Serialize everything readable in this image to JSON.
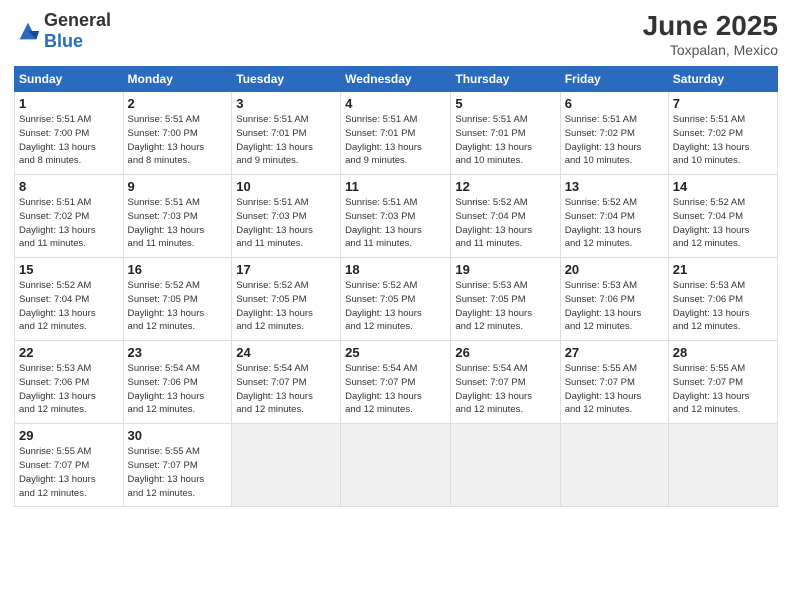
{
  "header": {
    "logo_general": "General",
    "logo_blue": "Blue",
    "month_year": "June 2025",
    "location": "Toxpalan, Mexico"
  },
  "calendar": {
    "days_of_week": [
      "Sunday",
      "Monday",
      "Tuesday",
      "Wednesday",
      "Thursday",
      "Friday",
      "Saturday"
    ],
    "weeks": [
      [
        {
          "day": "1",
          "info": "Sunrise: 5:51 AM\nSunset: 7:00 PM\nDaylight: 13 hours\nand 8 minutes."
        },
        {
          "day": "2",
          "info": "Sunrise: 5:51 AM\nSunset: 7:00 PM\nDaylight: 13 hours\nand 8 minutes."
        },
        {
          "day": "3",
          "info": "Sunrise: 5:51 AM\nSunset: 7:01 PM\nDaylight: 13 hours\nand 9 minutes."
        },
        {
          "day": "4",
          "info": "Sunrise: 5:51 AM\nSunset: 7:01 PM\nDaylight: 13 hours\nand 9 minutes."
        },
        {
          "day": "5",
          "info": "Sunrise: 5:51 AM\nSunset: 7:01 PM\nDaylight: 13 hours\nand 10 minutes."
        },
        {
          "day": "6",
          "info": "Sunrise: 5:51 AM\nSunset: 7:02 PM\nDaylight: 13 hours\nand 10 minutes."
        },
        {
          "day": "7",
          "info": "Sunrise: 5:51 AM\nSunset: 7:02 PM\nDaylight: 13 hours\nand 10 minutes."
        }
      ],
      [
        {
          "day": "8",
          "info": "Sunrise: 5:51 AM\nSunset: 7:02 PM\nDaylight: 13 hours\nand 11 minutes."
        },
        {
          "day": "9",
          "info": "Sunrise: 5:51 AM\nSunset: 7:03 PM\nDaylight: 13 hours\nand 11 minutes."
        },
        {
          "day": "10",
          "info": "Sunrise: 5:51 AM\nSunset: 7:03 PM\nDaylight: 13 hours\nand 11 minutes."
        },
        {
          "day": "11",
          "info": "Sunrise: 5:51 AM\nSunset: 7:03 PM\nDaylight: 13 hours\nand 11 minutes."
        },
        {
          "day": "12",
          "info": "Sunrise: 5:52 AM\nSunset: 7:04 PM\nDaylight: 13 hours\nand 11 minutes."
        },
        {
          "day": "13",
          "info": "Sunrise: 5:52 AM\nSunset: 7:04 PM\nDaylight: 13 hours\nand 12 minutes."
        },
        {
          "day": "14",
          "info": "Sunrise: 5:52 AM\nSunset: 7:04 PM\nDaylight: 13 hours\nand 12 minutes."
        }
      ],
      [
        {
          "day": "15",
          "info": "Sunrise: 5:52 AM\nSunset: 7:04 PM\nDaylight: 13 hours\nand 12 minutes."
        },
        {
          "day": "16",
          "info": "Sunrise: 5:52 AM\nSunset: 7:05 PM\nDaylight: 13 hours\nand 12 minutes."
        },
        {
          "day": "17",
          "info": "Sunrise: 5:52 AM\nSunset: 7:05 PM\nDaylight: 13 hours\nand 12 minutes."
        },
        {
          "day": "18",
          "info": "Sunrise: 5:52 AM\nSunset: 7:05 PM\nDaylight: 13 hours\nand 12 minutes."
        },
        {
          "day": "19",
          "info": "Sunrise: 5:53 AM\nSunset: 7:05 PM\nDaylight: 13 hours\nand 12 minutes."
        },
        {
          "day": "20",
          "info": "Sunrise: 5:53 AM\nSunset: 7:06 PM\nDaylight: 13 hours\nand 12 minutes."
        },
        {
          "day": "21",
          "info": "Sunrise: 5:53 AM\nSunset: 7:06 PM\nDaylight: 13 hours\nand 12 minutes."
        }
      ],
      [
        {
          "day": "22",
          "info": "Sunrise: 5:53 AM\nSunset: 7:06 PM\nDaylight: 13 hours\nand 12 minutes."
        },
        {
          "day": "23",
          "info": "Sunrise: 5:54 AM\nSunset: 7:06 PM\nDaylight: 13 hours\nand 12 minutes."
        },
        {
          "day": "24",
          "info": "Sunrise: 5:54 AM\nSunset: 7:07 PM\nDaylight: 13 hours\nand 12 minutes."
        },
        {
          "day": "25",
          "info": "Sunrise: 5:54 AM\nSunset: 7:07 PM\nDaylight: 13 hours\nand 12 minutes."
        },
        {
          "day": "26",
          "info": "Sunrise: 5:54 AM\nSunset: 7:07 PM\nDaylight: 13 hours\nand 12 minutes."
        },
        {
          "day": "27",
          "info": "Sunrise: 5:55 AM\nSunset: 7:07 PM\nDaylight: 13 hours\nand 12 minutes."
        },
        {
          "day": "28",
          "info": "Sunrise: 5:55 AM\nSunset: 7:07 PM\nDaylight: 13 hours\nand 12 minutes."
        }
      ],
      [
        {
          "day": "29",
          "info": "Sunrise: 5:55 AM\nSunset: 7:07 PM\nDaylight: 13 hours\nand 12 minutes."
        },
        {
          "day": "30",
          "info": "Sunrise: 5:55 AM\nSunset: 7:07 PM\nDaylight: 13 hours\nand 12 minutes."
        },
        {
          "day": "",
          "info": ""
        },
        {
          "day": "",
          "info": ""
        },
        {
          "day": "",
          "info": ""
        },
        {
          "day": "",
          "info": ""
        },
        {
          "day": "",
          "info": ""
        }
      ]
    ]
  }
}
